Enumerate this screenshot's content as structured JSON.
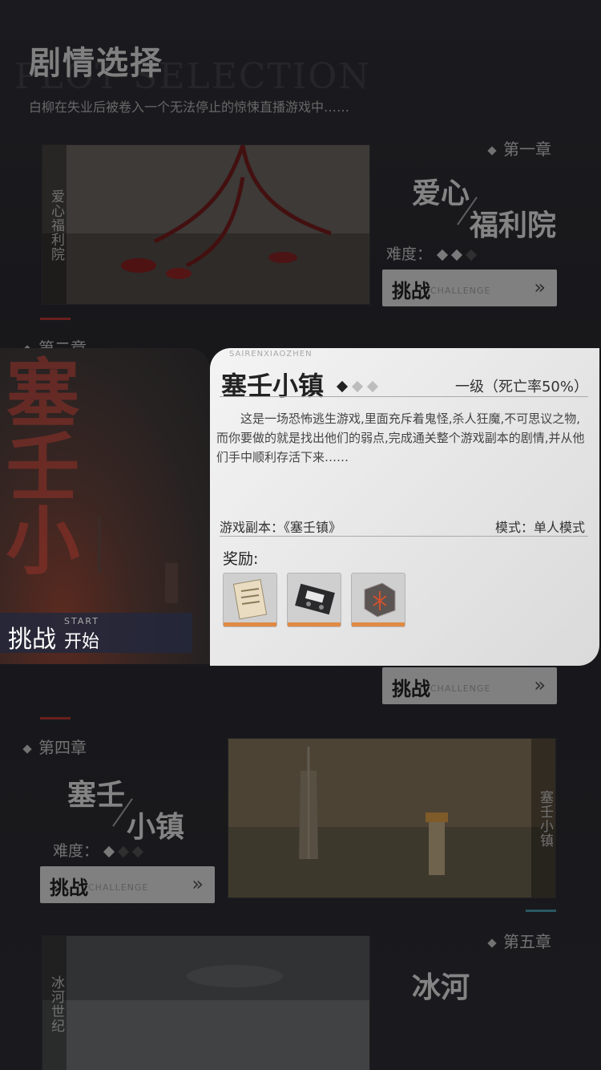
{
  "header": {
    "title": "剧情选择",
    "bg_text": "PLOT SELECTION",
    "subtitle": "白柳在失业后被卷入一个无法停止的惊悚直播游戏中……"
  },
  "chapters": [
    {
      "label": "第一章",
      "title1": "爱心",
      "title2": "福利院",
      "vertical": "爱心福利院",
      "difficulty_label": "难度：",
      "difficulty": 2,
      "challenge_label": "挑战",
      "challenge_en": "CHALLENGE"
    },
    {
      "label": "第二章"
    },
    {
      "challenge_label": "挑战",
      "challenge_en": "CHALLENGE"
    },
    {
      "label": "第四章",
      "title1": "塞壬",
      "title2": "小镇",
      "vertical": "塞壬小镇",
      "difficulty_label": "难度：",
      "difficulty": 1,
      "challenge_label": "挑战",
      "challenge_en": "CHALLENGE"
    },
    {
      "label": "第五章",
      "title1": "冰河",
      "vertical": "冰河世纪"
    }
  ],
  "modal": {
    "pinyin": "SAIRENXIAOZHEN",
    "title": "塞壬小镇",
    "big_vertical": "塞壬小",
    "difficulty": 1,
    "level": "一级（死亡率50%）",
    "description": "这是一场恐怖逃生游戏,里面充斥着鬼怪,杀人狂魔,不可思议之物,而你要做的就是找出他们的弱点,完成通关整个游戏副本的剧情,并从他们手中顺利存活下来……",
    "dungeon": "游戏副本：《塞壬镇》",
    "mode": "模式：单人模式",
    "reward_label": "奖励:",
    "rewards": [
      "letter-icon",
      "tape-icon",
      "rune-box-icon"
    ],
    "start_en": "START",
    "start_zh1": "挑战",
    "start_zh2": "开始"
  },
  "colors": {
    "accent_red": "#c03b34",
    "accent_cyan": "#4aa0b4",
    "reward_bar": "#e08a44"
  }
}
